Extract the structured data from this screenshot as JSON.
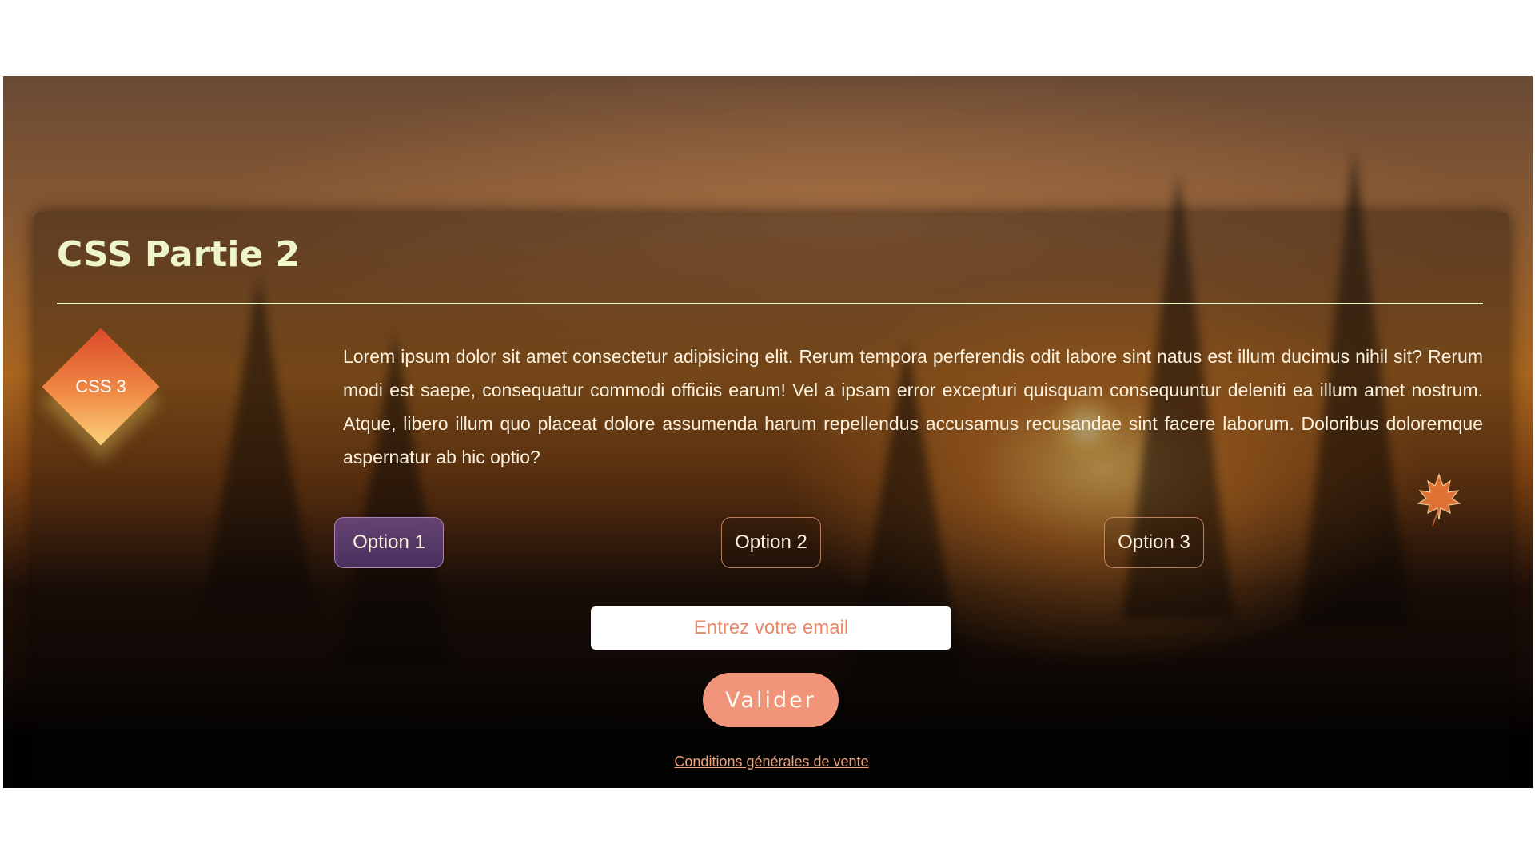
{
  "page": {
    "title": "CSS Partie 2",
    "badge_label": "CSS 3",
    "paragraph": "Lorem ipsum dolor sit amet consectetur adipisicing elit. Rerum tempora perferendis odit labore sint natus est illum ducimus nihil sit? Rerum modi est saepe, consequatur commodi officiis earum! Vel a ipsam error excepturi quisquam consequuntur deleniti ea illum amet nostrum. Atque, libero illum quo placeat dolore assumenda harum repellendus accusamus recusandae sint facere laborum. Doloribus doloremque aspernatur ab hic optio?"
  },
  "options": [
    {
      "label": "Option 1",
      "active": true
    },
    {
      "label": "Option 2",
      "active": false
    },
    {
      "label": "Option 3",
      "active": false
    }
  ],
  "form": {
    "email_placeholder": "Entrez votre email",
    "submit_label": "Valider"
  },
  "footer": {
    "terms_link": "Conditions générales de vente"
  },
  "icons": {
    "leaf": "maple-leaf-icon"
  },
  "colors": {
    "title": "#eef5c8",
    "accent": "#f0947a",
    "active_option": "#5e4480",
    "badge_gradient_start": "#dc4a2a",
    "badge_gradient_end": "#fbd27a"
  }
}
